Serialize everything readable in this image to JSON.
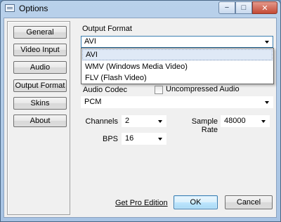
{
  "window": {
    "title": "Options",
    "controls": {
      "minimize": "−",
      "maximize": "□",
      "close": "✕"
    }
  },
  "sidebar": {
    "items": [
      {
        "label": "General"
      },
      {
        "label": "Video Input"
      },
      {
        "label": "Audio"
      },
      {
        "label": "Output Format"
      },
      {
        "label": "Skins"
      },
      {
        "label": "About"
      }
    ]
  },
  "output_format": {
    "label": "Output Format",
    "selected": "AVI",
    "options": [
      "AVI",
      "WMV (Windows Media Video)",
      "FLV (Flash Video)"
    ]
  },
  "audio_codec": {
    "label": "Audio Codec",
    "uncompressed_label": "Uncompressed Audio",
    "uncompressed_checked": false,
    "selected": "PCM"
  },
  "channels": {
    "label": "Channels",
    "value": "2"
  },
  "sample_rate": {
    "label": "Sample Rate",
    "value": "48000"
  },
  "bps": {
    "label": "BPS",
    "value": "16"
  },
  "footer": {
    "pro_link": "Get Pro Edition",
    "ok": "OK",
    "cancel": "Cancel"
  }
}
